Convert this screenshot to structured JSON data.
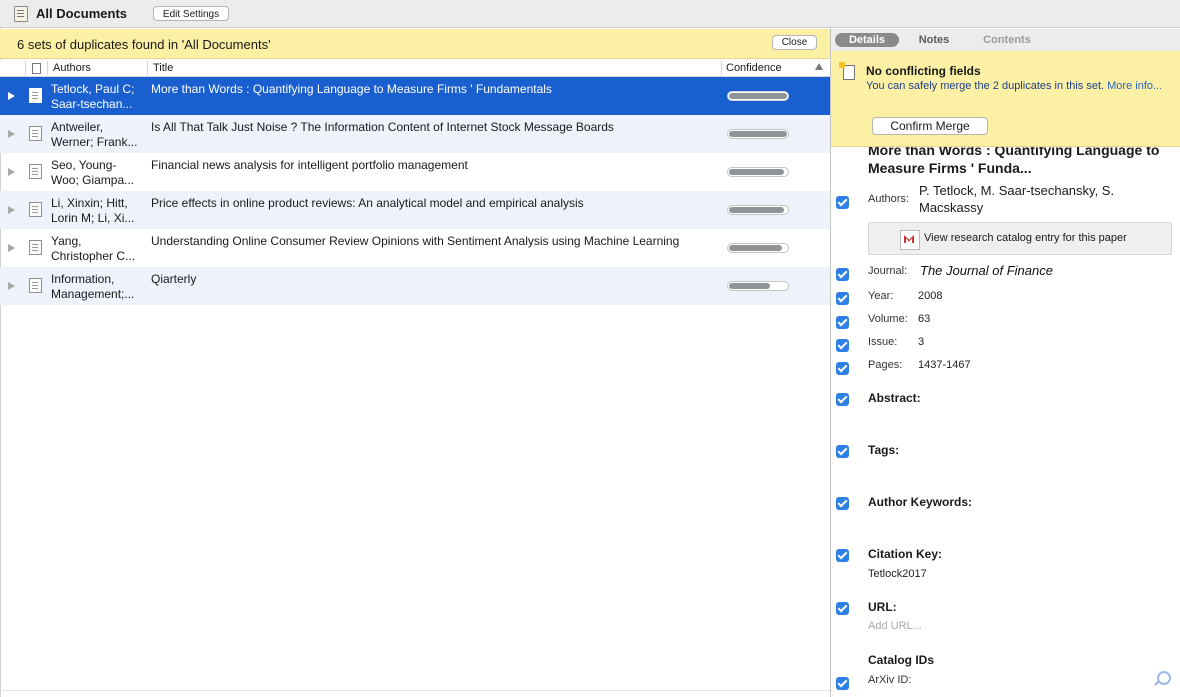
{
  "topbar": {
    "title": "All Documents",
    "edit_settings": "Edit Settings"
  },
  "banner": {
    "message": "6 sets of duplicates found in 'All Documents'",
    "close": "Close"
  },
  "table": {
    "headers": {
      "authors": "Authors",
      "title": "Title",
      "confidence": "Confidence"
    },
    "rows": [
      {
        "authors_line1": "Tetlock, Paul C;",
        "authors_line2": "Saar-tsechan...",
        "title": "More than Words : Quantifying Language to Measure Firms ' Fundamentals",
        "confidence": 1.0
      },
      {
        "authors_line1": "Antweiler,",
        "authors_line2": "Werner; Frank...",
        "title": "Is All That Talk Just Noise ? The Information Content of Internet Stock Message Boards",
        "confidence": 1.0
      },
      {
        "authors_line1": "Seo, Young-",
        "authors_line2": "Woo; Giampa...",
        "title": "Financial news analysis for intelligent portfolio management",
        "confidence": 0.95
      },
      {
        "authors_line1": "Li, Xinxin; Hitt,",
        "authors_line2": "Lorin M; Li, Xi...",
        "title": "Price effects in online product reviews: An analytical model and empirical analysis",
        "confidence": 0.95
      },
      {
        "authors_line1": "Yang,",
        "authors_line2": "Christopher C...",
        "title": "Understanding Online Consumer Review Opinions with Sentiment Analysis using Machine Learning",
        "confidence": 0.92
      },
      {
        "authors_line1": "Information,",
        "authors_line2": "Management;...",
        "title": "Qiarterly",
        "confidence": 0.7
      }
    ]
  },
  "right_panel": {
    "tabs": [
      "Details",
      "Notes",
      "Contents"
    ],
    "notice": {
      "title": "No conflicting fields",
      "body": "You can safely merge the 2 duplicates in this set.",
      "more": "More info...",
      "confirm": "Confirm Merge"
    },
    "details": {
      "title": "More than Words : Quantifying Language to Measure Firms ' Funda...",
      "authors_label": "Authors:",
      "authors": "P. Tetlock, M. Saar-tsechansky, S. Macskassy",
      "catalog_link": "View research catalog entry for this paper",
      "journal_label": "Journal:",
      "journal": "The Journal of Finance",
      "year_label": "Year:",
      "year": "2008",
      "volume_label": "Volume:",
      "volume": "63",
      "issue_label": "Issue:",
      "issue": "3",
      "pages_label": "Pages:",
      "pages": "1437-1467",
      "abstract_label": "Abstract:",
      "tags_label": "Tags:",
      "keywords_label": "Author Keywords:",
      "citation_label": "Citation Key:",
      "citation": "Tetlock2017",
      "url_label": "URL:",
      "url_placeholder": "Add URL...",
      "catalog_ids_label": "Catalog IDs",
      "arxiv_label": "ArXiv ID:"
    }
  },
  "colors": {
    "selection": "#1a5fd0",
    "banner": "#fcf0a5",
    "checkbox": "#2e7fe6"
  }
}
